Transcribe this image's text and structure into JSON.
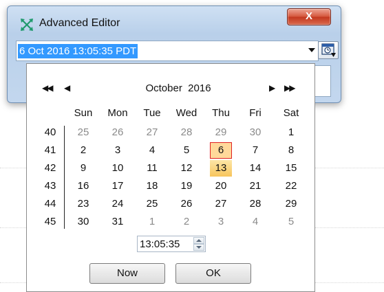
{
  "window": {
    "title": "Advanced Editor",
    "close_label": "X",
    "date_value": "6 Oct 2016 13:05:35 PDT"
  },
  "calendar": {
    "month_label": "October  2016",
    "nav": {
      "prev_year": "◀◀",
      "prev_month": "◀",
      "next_month": "▶",
      "next_year": "▶▶"
    },
    "weekdays": [
      "Sun",
      "Mon",
      "Tue",
      "Wed",
      "Thu",
      "Fri",
      "Sat"
    ],
    "weeks": [
      {
        "num": "40",
        "days": [
          "25",
          "26",
          "27",
          "28",
          "29",
          "30",
          "1"
        ]
      },
      {
        "num": "41",
        "days": [
          "2",
          "3",
          "4",
          "5",
          "6",
          "7",
          "8"
        ]
      },
      {
        "num": "42",
        "days": [
          "9",
          "10",
          "11",
          "12",
          "13",
          "14",
          "15"
        ]
      },
      {
        "num": "43",
        "days": [
          "16",
          "17",
          "18",
          "19",
          "20",
          "21",
          "22"
        ]
      },
      {
        "num": "44",
        "days": [
          "23",
          "24",
          "25",
          "26",
          "27",
          "28",
          "29"
        ]
      },
      {
        "num": "45",
        "days": [
          "30",
          "31",
          "1",
          "2",
          "3",
          "4",
          "5"
        ]
      }
    ],
    "today": "6",
    "selected": "13",
    "time_value": "13:05:35",
    "now_label": "Now",
    "ok_label": "OK"
  },
  "colors": {
    "selection": "#3399ff",
    "today_border": "#e02020",
    "today_fill": "#ffd89a",
    "selected_fill": "#f7c55c",
    "close_button": "#c3381f"
  },
  "icons": {
    "app": "cross-arrows-icon",
    "picker": "clock-calendar-icon",
    "dropdown": "chevron-down-icon"
  }
}
